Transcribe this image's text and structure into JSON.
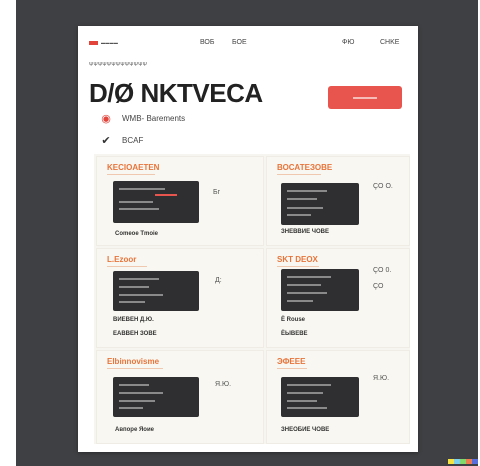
{
  "nav": {
    "logo_text": "▬▬▬▬",
    "links": [
      "ВОБ",
      "БОЕ",
      "ФЮ",
      "CHKE"
    ]
  },
  "header": {
    "subtitle": "ΨΨΨΨΨΨΨΨΨΨΨΨΨ",
    "title": "D/Ø NKTVECA",
    "meta": [
      {
        "icon": "target-icon",
        "text": "WMB- Barements"
      },
      {
        "icon": "check-icon",
        "text": "BCAF"
      }
    ]
  },
  "panels": [
    {
      "title": "KECIOAETEN",
      "side": "Бг",
      "footer": "Comeoe Tmoie"
    },
    {
      "title": "ВОСАТЕЗОВЕ",
      "side": "ÇO O.",
      "footer": "ЗНЕВВИЕ ЧОВЕ"
    },
    {
      "title": "L.Ezoor",
      "side": "Д:",
      "footer": "ВИЕВЕН Д.Ю."
    },
    {
      "title": "SKT DEOX",
      "side": "ÇO 0.",
      "footer": "Ё Rouse"
    },
    {
      "title": "Elbinnovisme",
      "side": "Я.Ю.",
      "footer": "Авпоре Яоие"
    },
    {
      "title": "ЭФЕЕЕ",
      "side": "Я.Ю.",
      "footer": "ЗНЕОБИЕ ЧОВЕ"
    }
  ],
  "panel_extra": {
    "row2_left_footer2": "ЕАВВЕН ЗОВЕ",
    "row2_right_footer2": "ЁЫВЕВЕ",
    "row2_right_side2": "ÇO"
  }
}
